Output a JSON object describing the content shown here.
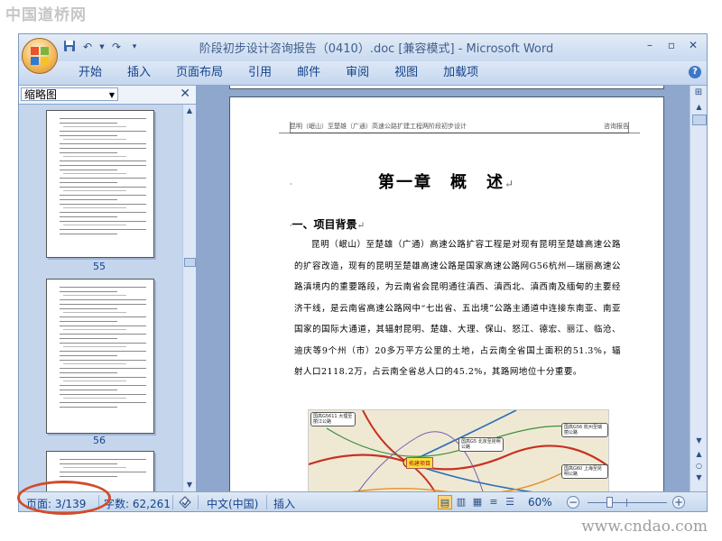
{
  "watermarks": {
    "top": "中国道桥网",
    "bottom": "www.cndao.com"
  },
  "window": {
    "title": "阶段初步设计咨询报告（0410）.doc [兼容模式] - Microsoft Word",
    "quick_access": {
      "save_icon": "save-icon",
      "undo_icon": "undo-icon",
      "redo_icon": "redo-icon",
      "customize_icon": "customize-icon"
    },
    "controls": {
      "minimize": "–",
      "maximize": "▫",
      "close": "✕"
    }
  },
  "ribbon": {
    "tabs": [
      "开始",
      "插入",
      "页面布局",
      "引用",
      "邮件",
      "审阅",
      "视图",
      "加载项"
    ],
    "help": "?"
  },
  "thumbnail_pane": {
    "title": "缩略图",
    "close": "✕",
    "pages": [
      {
        "number": "55"
      },
      {
        "number": "56"
      }
    ]
  },
  "document": {
    "header_left": "昆明（岷山）至楚雄（广通）高速公路扩建工程两阶段初步设计",
    "header_right": "咨询报告",
    "chapter_title": "第一章　概　述",
    "paragraph_mark": "↵",
    "section_title": "一、项目背景",
    "paragraph": "昆明（岷山）至楚雄（广通）高速公路扩容工程是对现有昆明至楚雄高速公路的扩容改造，现有的昆明至楚雄高速公路是国家高速公路网G56杭州—瑞丽高速公路滇境内的重要路段，为云南省会昆明通往滇西、滇西北、滇西南及缅甸的主要经济干线，是云南省高速公路网中“七出省、五出境”公路主通道中连接东南亚、南亚国家的国际大通道，其辐射昆明、楚雄、大理、保山、怒江、德宏、丽江、临沧、迪庆等9个州（市）20多万平方公里的土地，占云南全省国土面积的51.3%，辐射人口2118.2万，占云南全省总人口的45.2%，其路网地位十分重要。",
    "map": {
      "labels": [
        "国高G5611 大理至丽江公路",
        "国高G5 北京至昆明公路",
        "国高G56 杭州至瑞丽公路",
        "国高G60 上海至昆明公路"
      ],
      "project_label": "拓建项目"
    }
  },
  "status_bar": {
    "page": "页面: 3/139",
    "word_count": "字数: 62,261",
    "language": "中文(中国)",
    "insert_mode": "插入",
    "zoom": "60%",
    "zoom_level": 0.6
  },
  "colors": {
    "annotation_ellipse": "#d24b2a",
    "accent": "#15428b"
  }
}
